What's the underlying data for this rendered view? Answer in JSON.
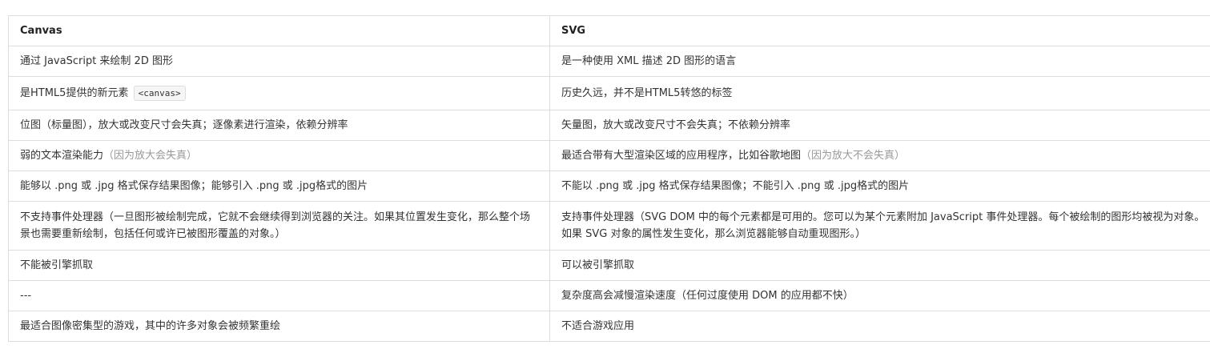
{
  "table": {
    "headers": [
      "Canvas",
      "SVG"
    ],
    "rows": [
      {
        "canvas": "通过 JavaScript 来绘制 2D 图形",
        "svg": "是一种使用 XML 描述 2D 图形的语言"
      },
      {
        "canvas": "是HTML5提供的新元素",
        "canvas_code": "<canvas>",
        "svg": "历史久远，并不是HTML5转悠的标签"
      },
      {
        "canvas": "位图（标量图），放大或改变尺寸会失真；逐像素进行渲染，依赖分辨率",
        "svg": "矢量图，放大或改变尺寸不会失真；不依赖分辨率"
      },
      {
        "canvas": "弱的文本渲染能力",
        "canvas_note": "（因为放大会失真）",
        "svg": "最适合带有大型渲染区域的应用程序，比如谷歌地图",
        "svg_note": "（因为放大不会失真）"
      },
      {
        "canvas": "能够以 .png 或 .jpg 格式保存结果图像；能够引入 .png 或 .jpg格式的图片",
        "svg": "不能以 .png 或 .jpg 格式保存结果图像；不能引入 .png 或 .jpg格式的图片"
      },
      {
        "canvas": "不支持事件处理器（一旦图形被绘制完成，它就不会继续得到浏览器的关注。如果其位置发生变化，那么整个场景也需要重新绘制，包括任何或许已被图形覆盖的对象。）",
        "svg": "支持事件处理器（SVG DOM 中的每个元素都是可用的。您可以为某个元素附加 JavaScript 事件处理器。每个被绘制的图形均被视为对象。如果 SVG 对象的属性发生变化，那么浏览器能够自动重现图形。）"
      },
      {
        "canvas": "不能被引擎抓取",
        "svg": "可以被引擎抓取"
      },
      {
        "canvas": "---",
        "svg": "复杂度高会减慢渲染速度（任何过度使用 DOM 的应用都不快）"
      },
      {
        "canvas": "最适合图像密集型的游戏，其中的许多对象会被频繁重绘",
        "svg": "不适合游戏应用"
      }
    ]
  }
}
